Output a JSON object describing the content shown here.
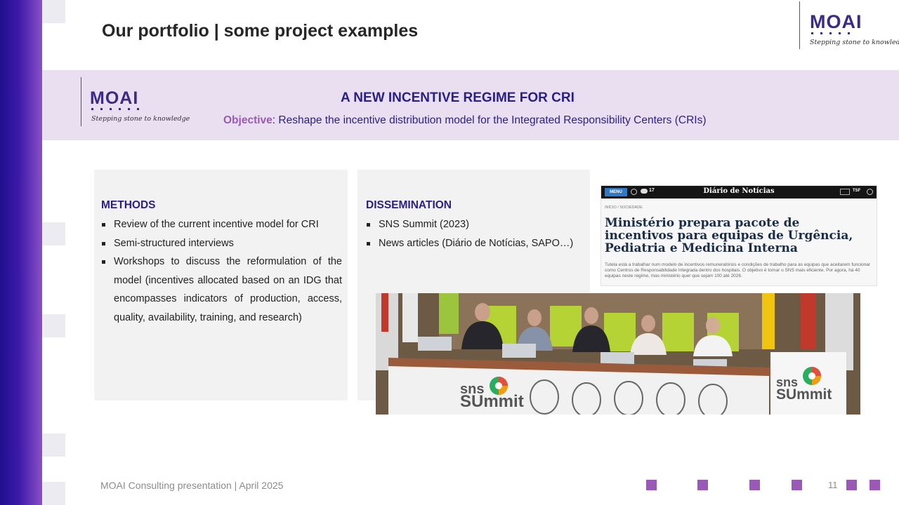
{
  "slide": {
    "title": "Our portfolio | some project examples",
    "logo": {
      "name": "MOAI",
      "tagline": "Stepping stone to knowledge"
    }
  },
  "banner": {
    "title": "A NEW INCENTIVE  REGIME  FOR CRI",
    "objective_label": "Objective",
    "objective_text": ": Reshape the incentive distribution model for the Integrated  Responsibility Centers (CRIs)"
  },
  "methods": {
    "heading": "METHODS",
    "items": [
      "Review of the current incentive model for CRI",
      "Semi-structured interviews",
      "Workshops to discuss the reformulation of the model (incentives allocated based on an IDG that encompasses indicators of production, access, quality, availability, training, and research)"
    ]
  },
  "dissemination": {
    "heading": "DISSEMINATION",
    "items": [
      "SNS Summit (2023)",
      "News articles (Diário de Notícias, SAPO…)"
    ]
  },
  "news_clip": {
    "menu_label": "MENU",
    "temperature": "17",
    "masthead": "Diário de Notícias",
    "right_label": "TSF",
    "category": "INÍCIO / SOCIEDADE",
    "headline": "Ministério prepara pacote de incentivos para equipas de Urgência, Pediatria e Medicina Interna",
    "lede": "Tutela está a trabalhar num modelo de incentivos remuneratórios e condições de trabalho para as equipas que aceitarem funcionar como Centros de Responsabilidade Integrada dentro dos hospitais. O objetivo é tornar o SNS mais eficiente. Por agora, há 40 equipas neste regime, mas ministério quer que sejam 100 até 2026."
  },
  "photo": {
    "sign_line1": "sns",
    "sign_line2": "SUmmit"
  },
  "footer": {
    "text": "MOAI Consulting presentation | April 2025",
    "page_number": "11"
  },
  "colors": {
    "accent": "#9b59b6",
    "navy": "#2a1f86",
    "banner_bg": "#e9dff0",
    "panel_bg": "#f2f2f2"
  }
}
